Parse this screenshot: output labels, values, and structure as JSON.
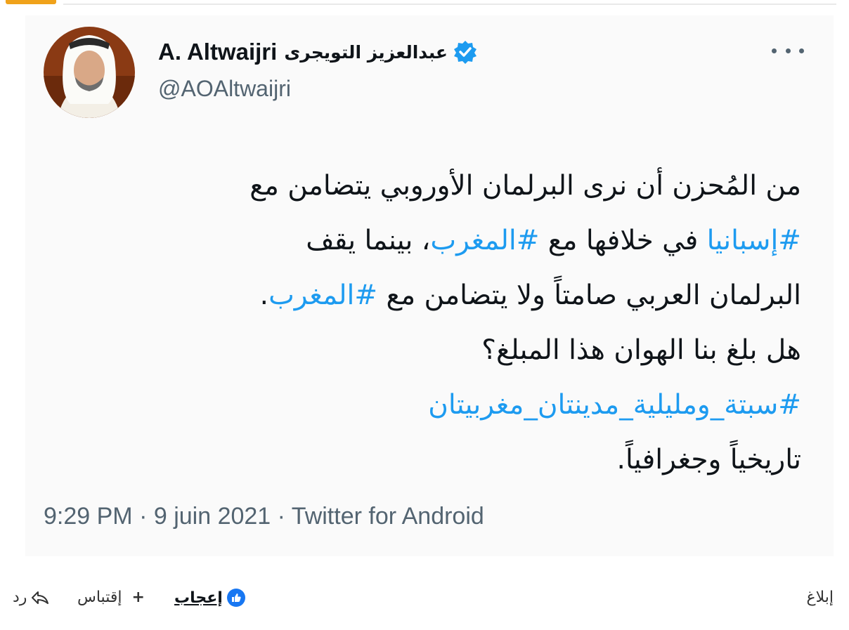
{
  "user": {
    "name_en": "A. Altwaijri",
    "name_ar": "عبدالعزيز التويجرى",
    "handle": "@AOAltwaijri"
  },
  "tweet": {
    "line1": "من المُحزن أن نرى البرلمان الأوروبي يتضامن مع",
    "line2_tag1": "#إسبانيا",
    "line2_mid": " في خلافها مع ",
    "line2_tag2": "#المغرب",
    "line2_end": "، بينما يقف",
    "line3_text": "البرلمان العربي صامتاً ولا يتضامن مع ",
    "line3_tag": "#المغرب",
    "line3_end": ".",
    "line4": "هل بلغ بنا الهوان هذا المبلغ؟",
    "line5_tag": "#سبتة_ومليلية_مدينتان_مغربيتان",
    "line6": "تاريخياً وجغرافياً."
  },
  "meta": "9:29 PM · 9 juin 2021 · Twitter for Android",
  "actions": {
    "reply": "رد",
    "quote": "إقتباس",
    "quote_prefix": "+",
    "like": "إعجاب",
    "report": "إبلاغ"
  },
  "colors": {
    "hashtag": "#1d9bf0",
    "verified": "#1d9bf0",
    "accent_tab": "#f0a21b",
    "like_icon": "#1877f2"
  },
  "icons": {
    "verified": "verified-badge-icon",
    "more": "more-dots-icon",
    "reply": "reply-arrow-icon",
    "like": "thumbs-up-icon"
  }
}
